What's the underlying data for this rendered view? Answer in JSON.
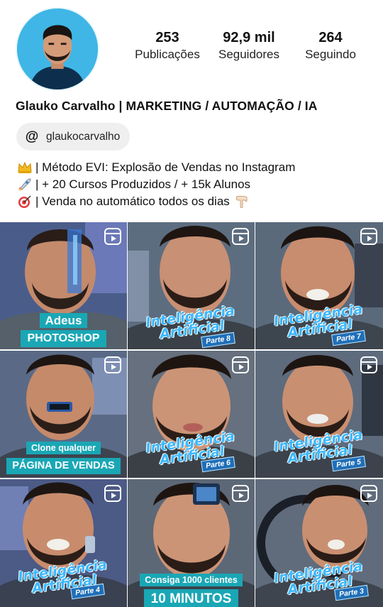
{
  "profile": {
    "avatar_alt": "avatar",
    "name": "Glauko Carvalho | MARKETING / AUTOMAÇÃO / IA",
    "threads_handle": "glaukocarvalho",
    "stats": [
      {
        "value": "253",
        "label": "Publicações"
      },
      {
        "value": "92,9 mil",
        "label": "Seguidores"
      },
      {
        "value": "264",
        "label": "Seguindo"
      }
    ],
    "bio": [
      {
        "icon": "crown-emoji",
        "text": "| Método EVI: Explosão de Vendas no Instagram"
      },
      {
        "icon": "rocket-emoji",
        "text": "| + 20 Cursos Produzidos / + 15k Alunos"
      },
      {
        "icon": "target-emoji",
        "text": "| Venda no automático todos os dias"
      }
    ],
    "bio_trailing_icon": "pointing-down-emoji"
  },
  "grid": {
    "tiles": [
      {
        "type": "reel",
        "caption_top": "Adeus",
        "caption_bottom": "PHOTOSHOP"
      },
      {
        "type": "reel",
        "ia_line1": "Inteligência",
        "ia_line2": "Artificial",
        "parte": "Parte 8"
      },
      {
        "type": "reel",
        "ia_line1": "Inteligência",
        "ia_line2": "Artificial",
        "parte": "Parte 7"
      },
      {
        "type": "reel",
        "caption_top": "Clone qualquer",
        "caption_bottom": "PÁGINA DE VENDAS"
      },
      {
        "type": "reel",
        "ia_line1": "Inteligência",
        "ia_line2": "Artificial",
        "parte": "Parte 6"
      },
      {
        "type": "reel",
        "ia_line1": "Inteligência",
        "ia_line2": "Artificial",
        "parte": "Parte 5"
      },
      {
        "type": "reel",
        "ia_line1": "Inteligência",
        "ia_line2": "Artificial",
        "parte": "Parte 4"
      },
      {
        "type": "reel",
        "caption_top": "Consiga 1000 clientes",
        "caption_bottom": "10 MINUTOS"
      },
      {
        "type": "reel",
        "ia_line1": "Inteligência",
        "ia_line2": "Artificial",
        "parte": "Parte 3"
      }
    ]
  },
  "colors": {
    "accent_teal": "#1aa7b5",
    "ia_blue": "#3bb8ff",
    "avatar_bg": "#3fb6e6"
  }
}
